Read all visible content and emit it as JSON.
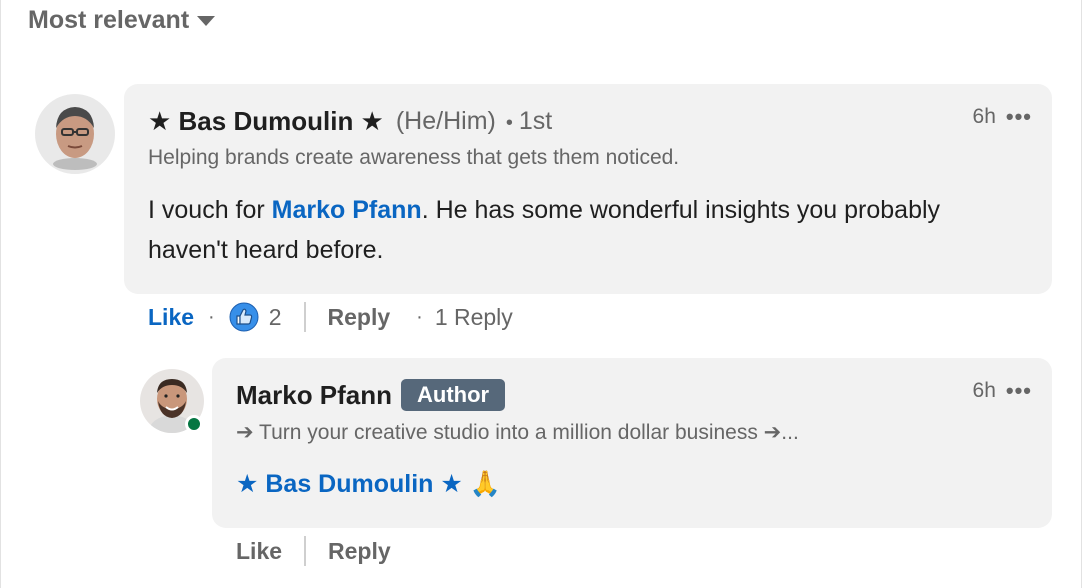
{
  "sort": {
    "label": "Most relevant"
  },
  "comments": [
    {
      "author": "★ Bas Dumoulin ★",
      "pronouns": "(He/Him)",
      "degree": "1st",
      "headline": "Helping brands create awareness that gets them noticed.",
      "time": "6h",
      "more": "•••",
      "text_before": "I vouch for ",
      "mention": "Marko Pfann",
      "text_after": ". He has some wonderful insights you probably haven't heard before.",
      "actions": {
        "like": "Like",
        "reaction_count": "2",
        "reply": "Reply",
        "replies": "1 Reply"
      }
    },
    {
      "author": "Marko Pfann",
      "badge": "Author",
      "headline": "➔ Turn your creative studio into a million dollar business ➔...",
      "time": "6h",
      "more": "•••",
      "mention": "★ Bas Dumoulin ★",
      "emoji": "🙏",
      "actions": {
        "like": "Like",
        "reply": "Reply"
      }
    }
  ],
  "colors": {
    "link": "#0a66c2",
    "badge": "#56687a",
    "online": "#057642",
    "bubble": "#f2f2f2"
  },
  "icons": {
    "reaction": "thumbs-up-like-icon",
    "sort": "caret-down-icon",
    "more": "ellipsis-icon"
  }
}
